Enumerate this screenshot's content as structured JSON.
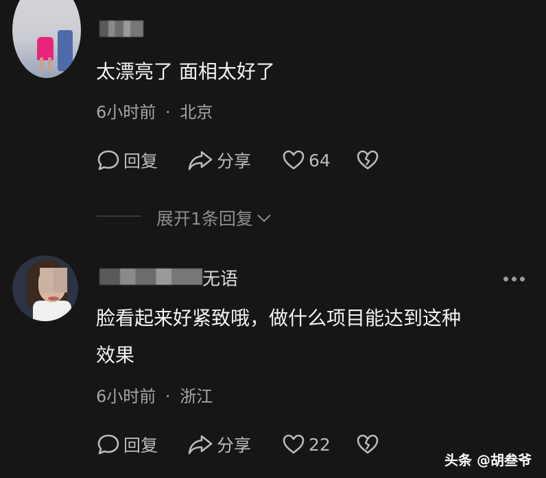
{
  "comments": [
    {
      "text": "太漂亮了 面相太好了",
      "time": "6小时前",
      "location": "北京",
      "reply_label": "回复",
      "share_label": "分享",
      "likes": "64"
    },
    {
      "name_tail": "无语",
      "text_line1": "脸看起来好紧致哦，做什么项目能达到这种",
      "text_line2": "效果",
      "time": "6小时前",
      "location": "浙江",
      "reply_label": "回复",
      "share_label": "分享",
      "likes": "22"
    }
  ],
  "expand_replies": "展开1条回复",
  "meta_separator": "·",
  "watermark": "头条 @胡叁爷",
  "icons": {
    "reply": "speech-bubble-icon",
    "share": "share-arrow-icon",
    "like": "heart-icon",
    "dislike": "broken-heart-icon",
    "more": "more-dots-icon",
    "expand": "chevron-down-icon"
  },
  "colors": {
    "background": "#161616",
    "text": "#f4f4f4",
    "muted": "#a7a7a7"
  }
}
